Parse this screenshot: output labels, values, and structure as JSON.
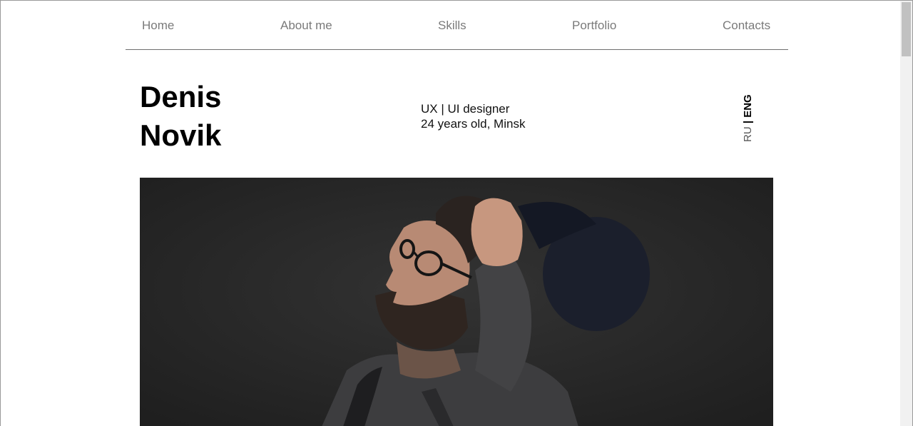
{
  "nav": {
    "items": [
      {
        "label": "Home"
      },
      {
        "label": "About me"
      },
      {
        "label": "Skills"
      },
      {
        "label": "Portfolio"
      },
      {
        "label": "Contacts"
      }
    ]
  },
  "profile": {
    "first_name": "Denis",
    "last_name": "Novik",
    "role": "UX | UI designer",
    "details": "24 years old, Minsk"
  },
  "language_switch": {
    "ru": "RU",
    "separator": "|",
    "eng": "ENG",
    "active": "ENG"
  },
  "hero": {
    "description_icon": "portrait-photo",
    "background_color": "#272727"
  },
  "colors": {
    "nav_text": "#7a7a7a",
    "heading": "#000000",
    "divider": "#6e6e6e"
  }
}
